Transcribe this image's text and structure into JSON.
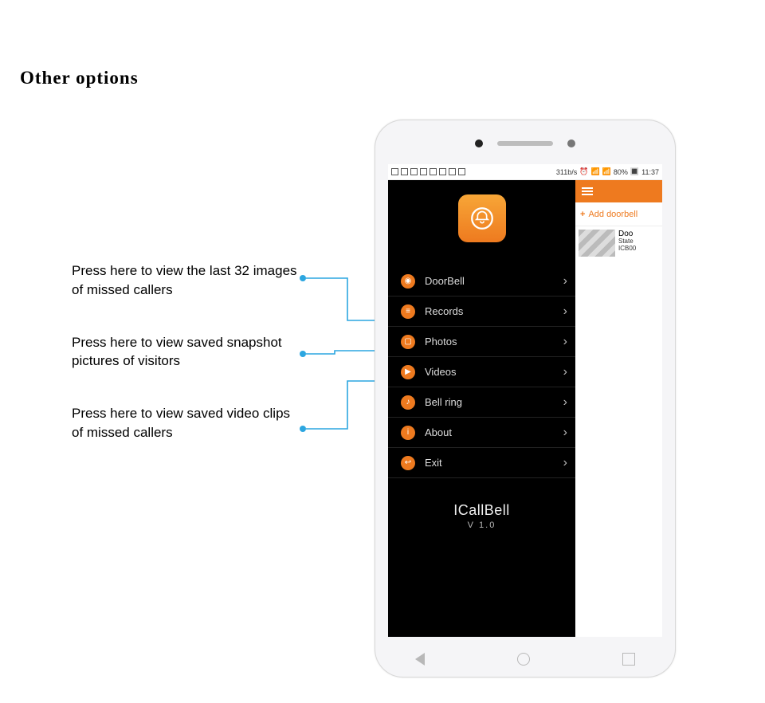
{
  "page": {
    "title": "Other options"
  },
  "annotations": [
    "Press here to view the last 32 images of missed callers",
    "Press here to view saved snapshot pictures of visitors",
    "Press here to view saved video clips of missed callers"
  ],
  "status_bar": {
    "left_icons": [
      "app",
      "user",
      "trash",
      "tab",
      "image",
      "refresh",
      "globe",
      "sync"
    ],
    "speed": "311b/s",
    "battery": "80%",
    "time": "11:37"
  },
  "app": {
    "logo_icon": "bell-icon",
    "menu": [
      {
        "icon": "doorbell-icon",
        "label": "DoorBell"
      },
      {
        "icon": "records-icon",
        "label": "Records"
      },
      {
        "icon": "photos-icon",
        "label": "Photos"
      },
      {
        "icon": "videos-icon",
        "label": "Videos"
      },
      {
        "icon": "bellring-icon",
        "label": "Bell ring"
      },
      {
        "icon": "about-icon",
        "label": "About"
      },
      {
        "icon": "exit-icon",
        "label": "Exit"
      }
    ],
    "brand_name": "ICallBell",
    "brand_version": "V 1.0",
    "right_panel": {
      "add_label": "Add doorbell",
      "device_name": "Doo",
      "device_state": "State",
      "device_id": "ICB00"
    }
  }
}
